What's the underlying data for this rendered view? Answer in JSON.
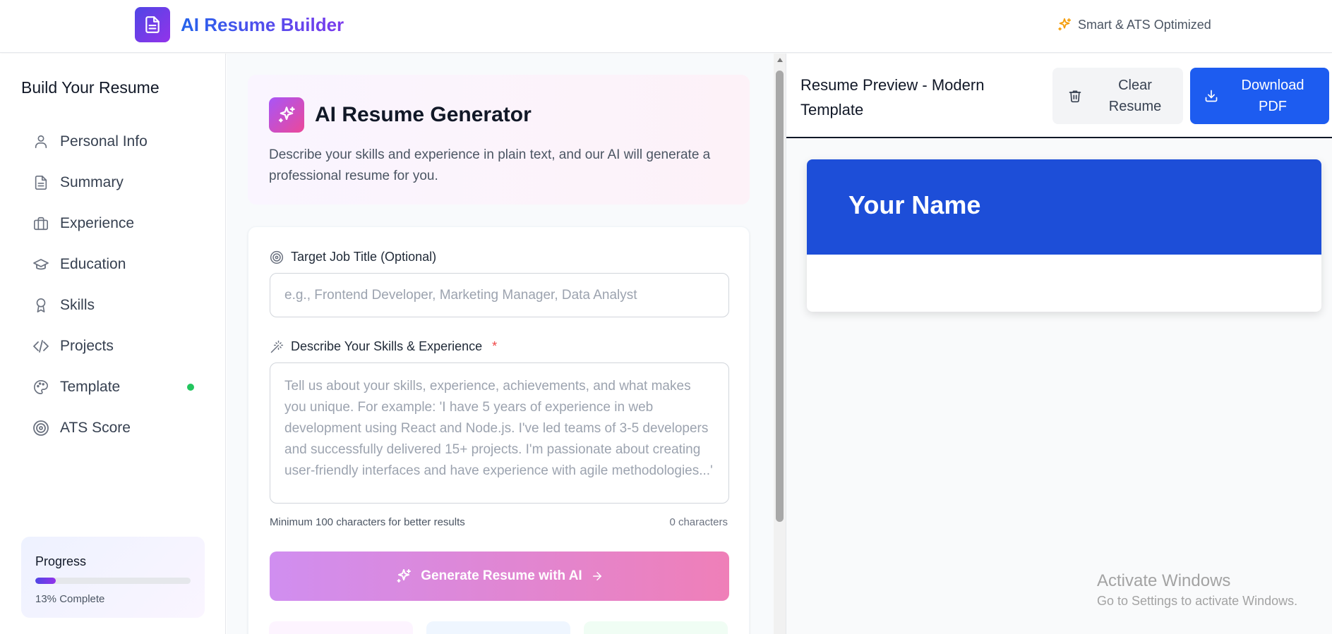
{
  "header": {
    "app_title": "AI Resume Builder",
    "tagline": "Smart & ATS Optimized"
  },
  "sidebar": {
    "heading": "Build Your Resume",
    "items": [
      {
        "label": "Personal Info",
        "icon": "user-icon"
      },
      {
        "label": "Summary",
        "icon": "document-icon"
      },
      {
        "label": "Experience",
        "icon": "briefcase-icon"
      },
      {
        "label": "Education",
        "icon": "graduation-cap-icon"
      },
      {
        "label": "Skills",
        "icon": "award-icon"
      },
      {
        "label": "Projects",
        "icon": "code-icon"
      },
      {
        "label": "Template",
        "icon": "palette-icon",
        "status_dot": "#22c55e"
      },
      {
        "label": "ATS Score",
        "icon": "target-icon"
      }
    ],
    "progress": {
      "title": "Progress",
      "value": 0.13,
      "text": "13% Complete"
    }
  },
  "generator": {
    "title": "AI Resume Generator",
    "description": "Describe your skills and experience in plain text, and our AI will generate a professional resume for you.",
    "job_title_label": "Target Job Title (Optional)",
    "job_title_placeholder": "e.g., Frontend Developer, Marketing Manager, Data Analyst",
    "job_title_value": "",
    "skills_label": "Describe Your Skills & Experience",
    "required_mark": "*",
    "skills_placeholder": "Tell us about your skills, experience, achievements, and what makes you unique. For example: 'I have 5 years of experience in web development using React and Node.js. I've led teams of 3-5 developers and successfully delivered 15+ projects. I'm passionate about creating user-friendly interfaces and have experience with agile methodologies...'",
    "skills_value": "",
    "hint": "Minimum 100 characters for better results",
    "char_count": "0 characters",
    "generate_label": "Generate Resume with AI"
  },
  "preview": {
    "title": "Resume Preview - Modern Template",
    "clear_label": "Clear Resume",
    "download_label": "Download PDF",
    "resume_name": "Your Name"
  },
  "watermark": {
    "title": "Activate Windows",
    "subtitle": "Go to Settings to activate Windows."
  },
  "colors": {
    "brand_gradient_start": "#4f46e5",
    "brand_gradient_end": "#9333ea",
    "primary": "#1d5cf0",
    "resume_header": "#1d4ed8",
    "generate_gradient_start": "#d08ef0",
    "generate_gradient_end": "#ef7fb8",
    "required": "#ef4444",
    "tagline_icon": "#f59e0b"
  }
}
